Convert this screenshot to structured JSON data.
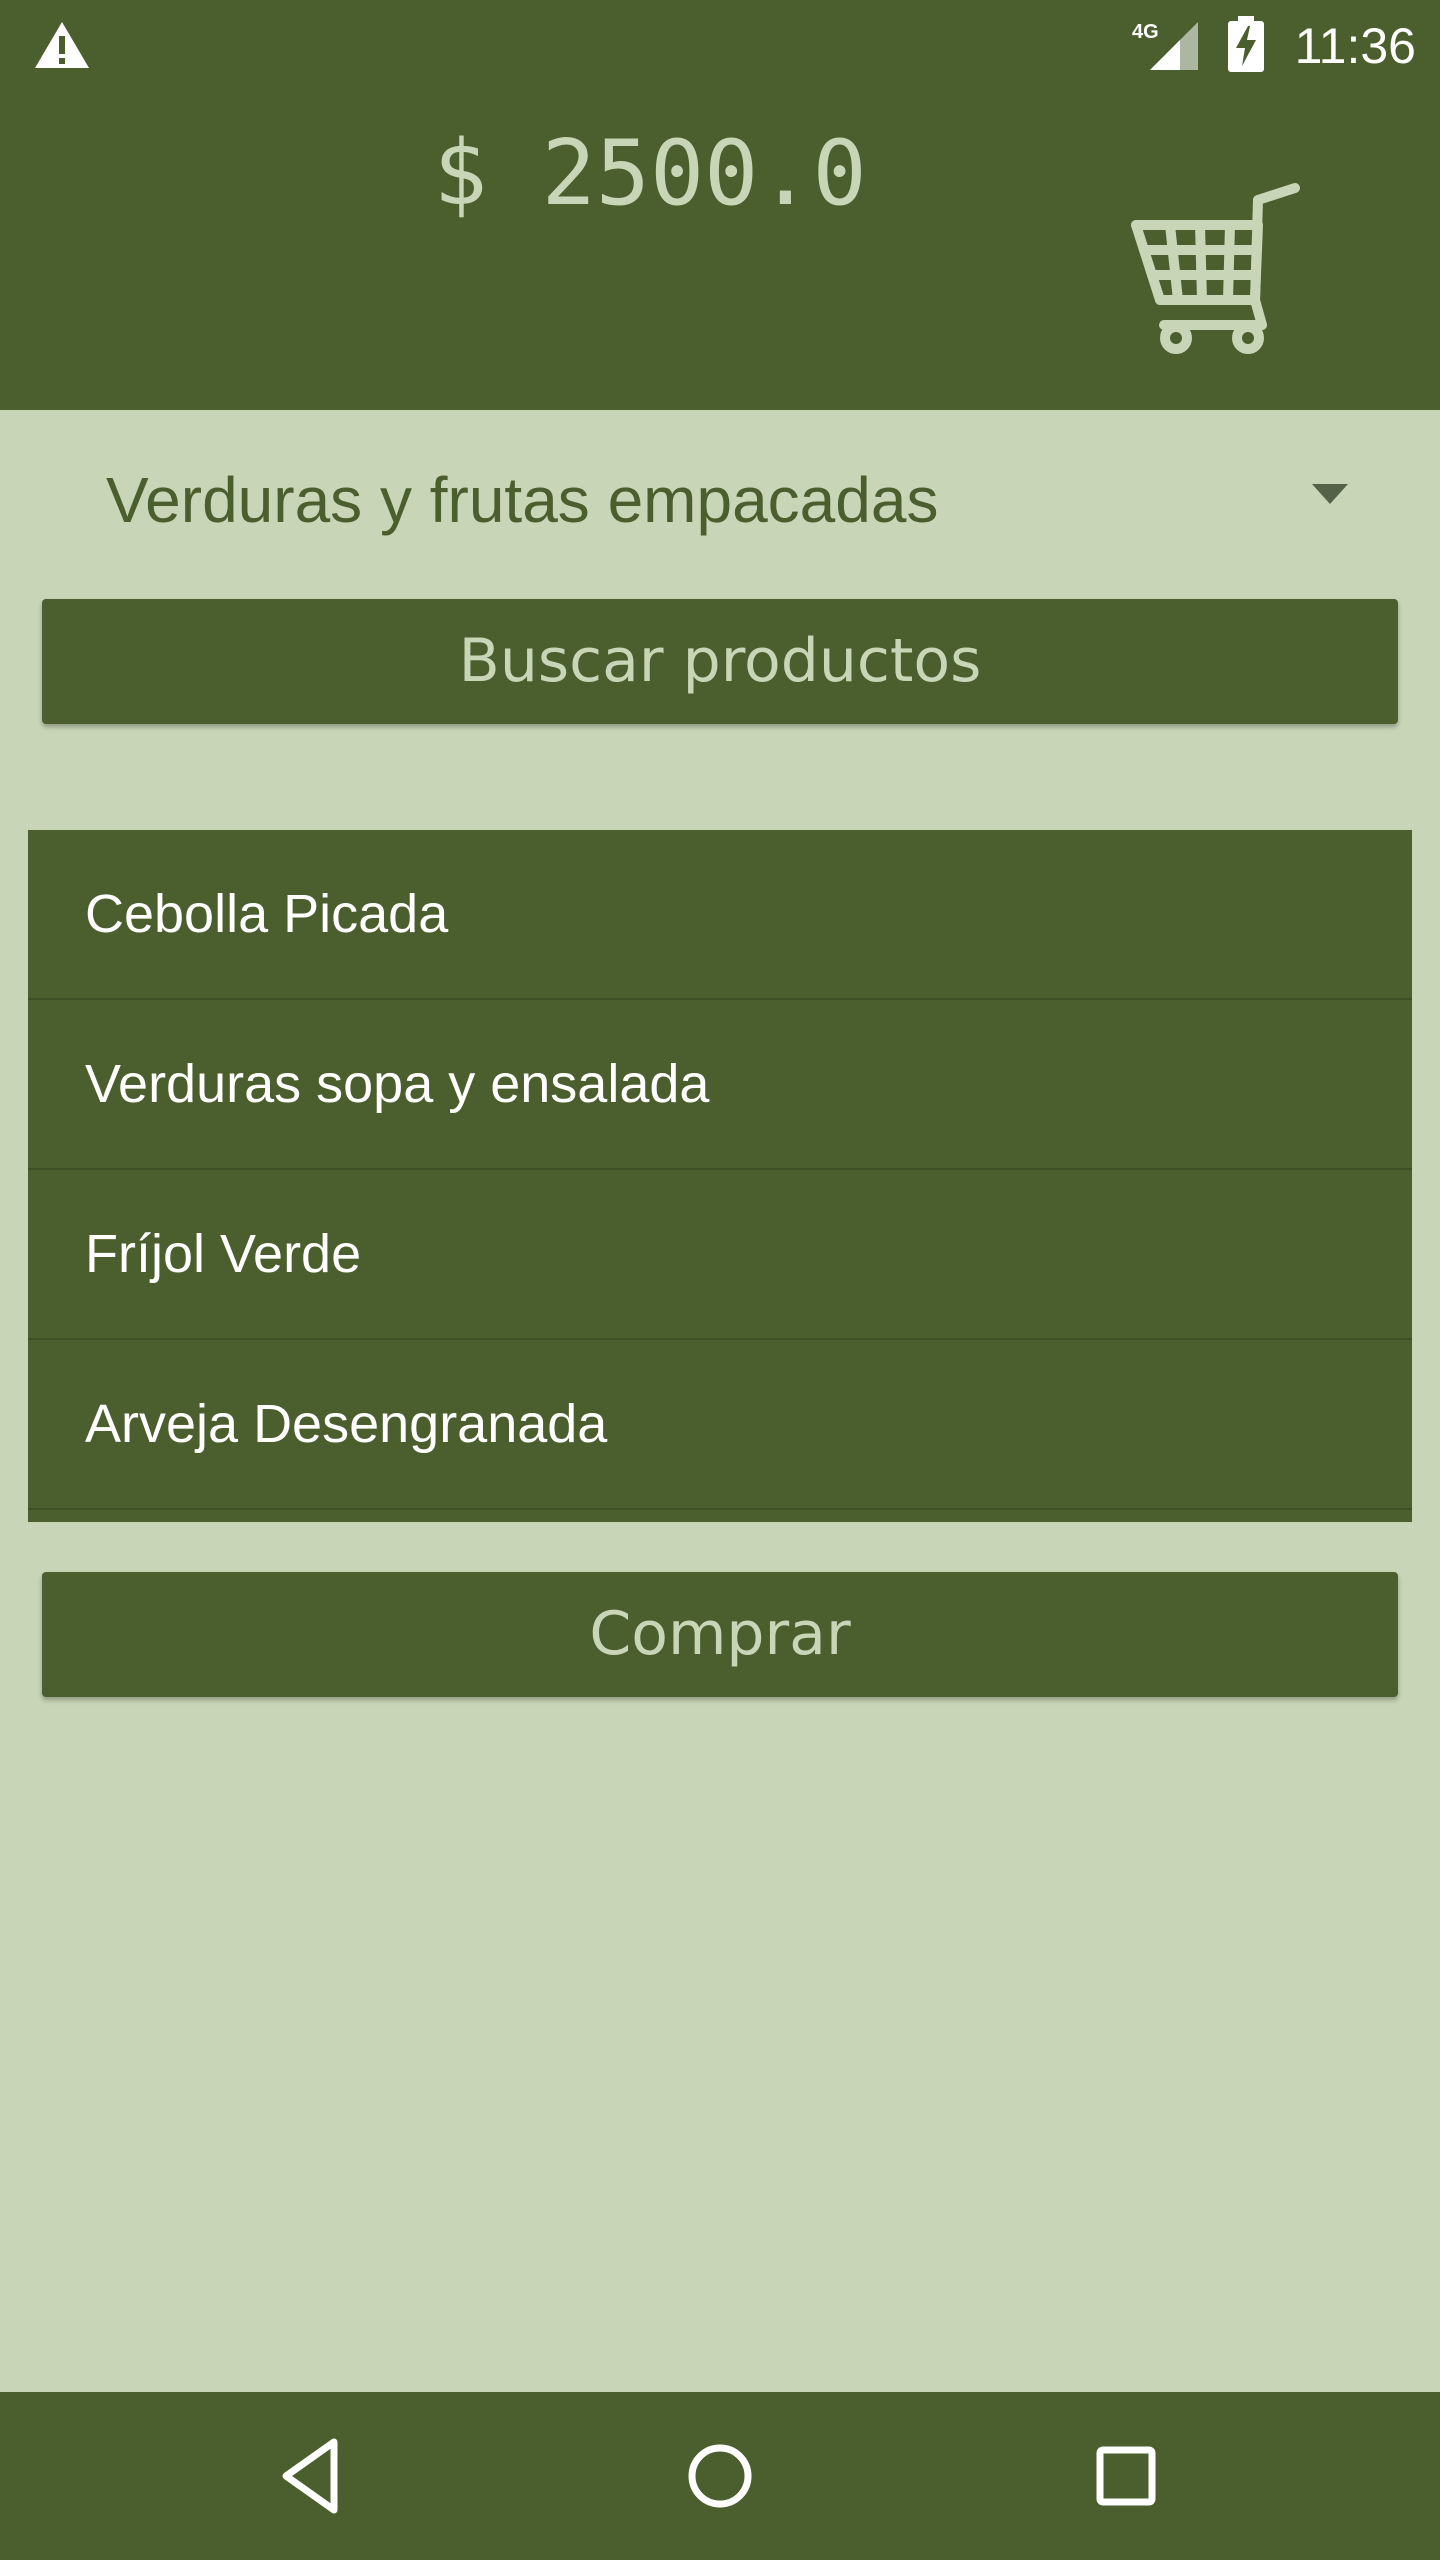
{
  "status_bar": {
    "network_label": "4G",
    "time": "11:36",
    "icons": [
      "warning-icon",
      "signal-4g-icon",
      "battery-charging-icon"
    ]
  },
  "header": {
    "balance": "$ 2500.0",
    "cart_icon": "shopping-cart-icon"
  },
  "category_spinner": {
    "selected": "Verduras y frutas empacadas",
    "arrow_icon": "dropdown-arrow-icon"
  },
  "search_button": {
    "label": "Buscar productos"
  },
  "products": [
    "Cebolla Picada",
    "Verduras sopa y ensalada",
    "Fríjol Verde",
    "Arveja Desengranada"
  ],
  "buy_button": {
    "label": "Comprar"
  },
  "nav_bar": {
    "icons": [
      "back-icon",
      "home-icon",
      "recents-icon"
    ]
  },
  "colors": {
    "primary": "#4b5e2d",
    "background": "#c8d5b6",
    "accent_text": "#c8d5b6",
    "list_text": "#ffffff"
  }
}
